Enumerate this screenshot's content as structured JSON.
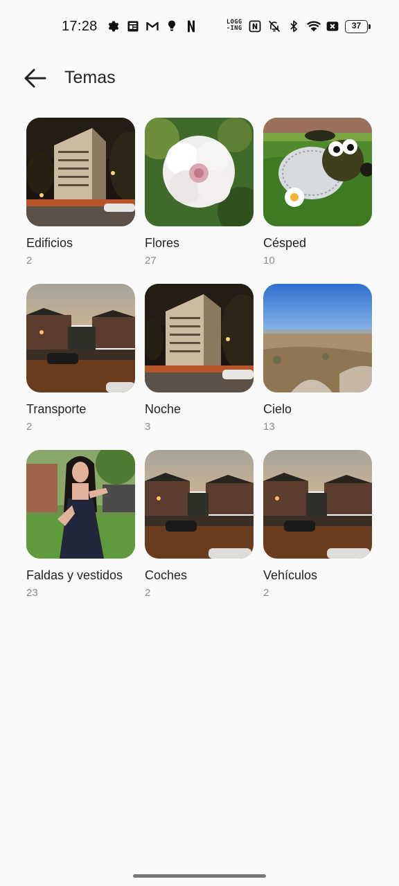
{
  "status_bar": {
    "time": "17:28",
    "logging_line1": "LOGG",
    "logging_line2": "-ING",
    "battery": "37"
  },
  "header": {
    "title": "Temas"
  },
  "topics": [
    {
      "name": "Edificios",
      "count": "2"
    },
    {
      "name": "Flores",
      "count": "27"
    },
    {
      "name": "Césped",
      "count": "10"
    },
    {
      "name": "Transporte",
      "count": "2"
    },
    {
      "name": "Noche",
      "count": "3"
    },
    {
      "name": "Cielo",
      "count": "13"
    },
    {
      "name": "Faldas y vestidos",
      "count": "23"
    },
    {
      "name": "Coches",
      "count": "2"
    },
    {
      "name": "Vehículos",
      "count": "2"
    }
  ]
}
